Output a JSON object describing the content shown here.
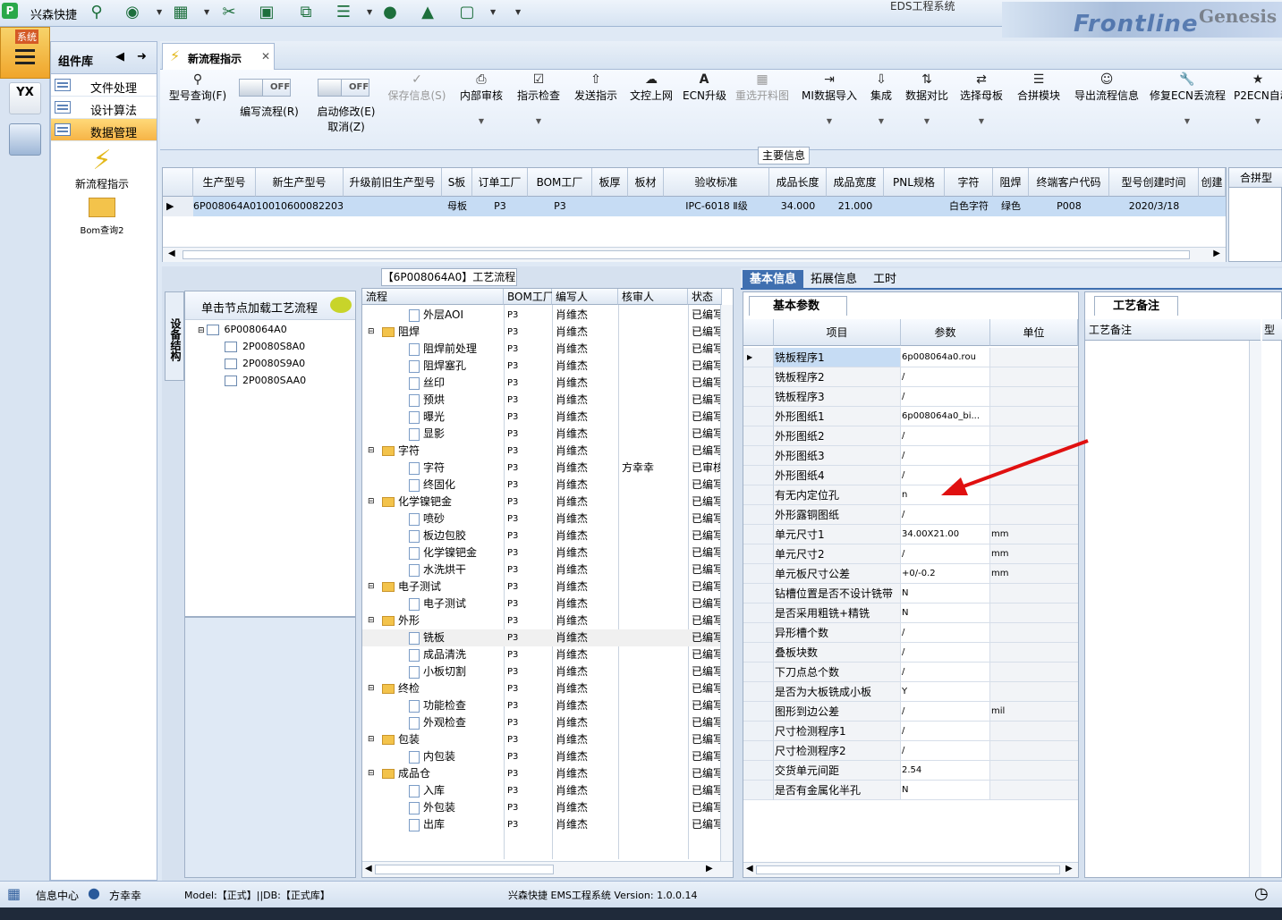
{
  "app": {
    "name": "兴森快捷",
    "window_title": "EDS工程系统",
    "banner_text": "Frontline",
    "banner_text2": "Genesis"
  },
  "system": {
    "label": "系统"
  },
  "component_panel": {
    "title": "组件库",
    "items": [
      {
        "label": "文件处理"
      },
      {
        "label": "设计算法"
      },
      {
        "label": "数据管理",
        "selected": true
      }
    ],
    "icons": [
      {
        "label": "新流程指示"
      },
      {
        "label": "Bom查询2"
      }
    ]
  },
  "doc_tab": {
    "label": "新流程指示"
  },
  "toolbar": {
    "items": [
      {
        "label": "型号查询(F)",
        "icon": "search-icon"
      },
      {
        "label": "编写流程(R)",
        "toggle": "OFF"
      },
      {
        "label": "启动修改(E)",
        "label2": "取消(Z)",
        "toggle": "OFF"
      },
      {
        "label": "保存信息(S)",
        "icon": "check-icon",
        "disabled": true
      },
      {
        "label": "内部审核",
        "icon": "printer-icon"
      },
      {
        "label": "指示检查",
        "icon": "checkbox-icon"
      },
      {
        "label": "发送指示",
        "icon": "upload-icon"
      },
      {
        "label": "文控上网",
        "icon": "cloud-upload-icon"
      },
      {
        "label": "ECN升级",
        "icon": "bold-a-icon"
      },
      {
        "label": "重选开料图",
        "icon": "image-icon",
        "disabled": true
      },
      {
        "label": "MI数据导入",
        "icon": "import-icon"
      },
      {
        "label": "集成",
        "icon": "download-icon"
      },
      {
        "label": "数据对比",
        "icon": "compare-icon"
      },
      {
        "label": "选择母板",
        "icon": "shuffle-icon"
      },
      {
        "label": "合拼模块",
        "icon": "list-icon"
      },
      {
        "label": "导出流程信息",
        "icon": "smile-icon"
      },
      {
        "label": "修复ECN丢流程",
        "icon": "wrench-icon"
      },
      {
        "label": "P2ECN自动",
        "icon": "star-icon"
      }
    ]
  },
  "main_info": {
    "label": "主要信息"
  },
  "grid1": {
    "columns": [
      "生产型号",
      "新生产型号",
      "升级前旧生产型号",
      "S板",
      "订单工厂",
      "BOM工厂",
      "板厚",
      "板材",
      "验收标准",
      "成品长度",
      "成品宽度",
      "PNL规格",
      "字符",
      "阻焊",
      "终端客户代码",
      "型号创建时间",
      "创建"
    ],
    "rows": [
      [
        "6P008064A0",
        "10010600082203",
        "",
        "母板",
        "P3",
        "P3",
        "",
        "",
        "IPC-6018 Ⅱ级",
        "34.000",
        "21.000",
        "",
        "白色字符",
        "绿色",
        "P008",
        "2020/3/18",
        ""
      ]
    ],
    "right_header": "合拼型"
  },
  "flow_title": "【6P008064A0】工艺流程",
  "structure_tab": "设备结构",
  "tree": {
    "header": "单击节点加载工艺流程",
    "root": "6P008064A0",
    "children": [
      "2P0080S8A0",
      "2P0080S9A0",
      "2P0080SAA0"
    ]
  },
  "flow": {
    "columns": [
      "流程",
      "BOM工厂",
      "编写人",
      "核审人",
      "状态"
    ],
    "rows": [
      {
        "name": "外层AOI",
        "level": 2,
        "bom": "P3",
        "writer": "肖维杰",
        "reviewer": "",
        "status": "已编写"
      },
      {
        "name": "阻焊",
        "level": 1,
        "bom": "P3",
        "writer": "肖维杰",
        "reviewer": "",
        "status": "已编写"
      },
      {
        "name": "阻焊前处理",
        "level": 2,
        "bom": "P3",
        "writer": "肖维杰",
        "reviewer": "",
        "status": "已编写"
      },
      {
        "name": "阻焊塞孔",
        "level": 2,
        "bom": "P3",
        "writer": "肖维杰",
        "reviewer": "",
        "status": "已编写"
      },
      {
        "name": "丝印",
        "level": 2,
        "bom": "P3",
        "writer": "肖维杰",
        "reviewer": "",
        "status": "已编写"
      },
      {
        "name": "预烘",
        "level": 2,
        "bom": "P3",
        "writer": "肖维杰",
        "reviewer": "",
        "status": "已编写"
      },
      {
        "name": "曝光",
        "level": 2,
        "bom": "P3",
        "writer": "肖维杰",
        "reviewer": "",
        "status": "已编写"
      },
      {
        "name": "显影",
        "level": 2,
        "bom": "P3",
        "writer": "肖维杰",
        "reviewer": "",
        "status": "已编写"
      },
      {
        "name": "字符",
        "level": 1,
        "bom": "P3",
        "writer": "肖维杰",
        "reviewer": "",
        "status": "已编写"
      },
      {
        "name": "字符",
        "level": 2,
        "bom": "P3",
        "writer": "肖维杰",
        "reviewer": "方幸幸",
        "status": "已审核"
      },
      {
        "name": "终固化",
        "level": 2,
        "bom": "P3",
        "writer": "肖维杰",
        "reviewer": "",
        "status": "已编写"
      },
      {
        "name": "化学镍钯金",
        "level": 1,
        "bom": "P3",
        "writer": "肖维杰",
        "reviewer": "",
        "status": "已编写"
      },
      {
        "name": "喷砂",
        "level": 2,
        "bom": "P3",
        "writer": "肖维杰",
        "reviewer": "",
        "status": "已编写"
      },
      {
        "name": "板边包胶",
        "level": 2,
        "bom": "P3",
        "writer": "肖维杰",
        "reviewer": "",
        "status": "已编写"
      },
      {
        "name": "化学镍钯金",
        "level": 2,
        "bom": "P3",
        "writer": "肖维杰",
        "reviewer": "",
        "status": "已编写"
      },
      {
        "name": "水洗烘干",
        "level": 2,
        "bom": "P3",
        "writer": "肖维杰",
        "reviewer": "",
        "status": "已编写"
      },
      {
        "name": "电子测试",
        "level": 1,
        "bom": "P3",
        "writer": "肖维杰",
        "reviewer": "",
        "status": "已编写"
      },
      {
        "name": "电子测试",
        "level": 2,
        "bom": "P3",
        "writer": "肖维杰",
        "reviewer": "",
        "status": "已编写"
      },
      {
        "name": "外形",
        "level": 1,
        "bom": "P3",
        "writer": "肖维杰",
        "reviewer": "",
        "status": "已编写"
      },
      {
        "name": "铣板",
        "level": 2,
        "bom": "P3",
        "writer": "肖维杰",
        "reviewer": "",
        "status": "已编写",
        "selected": true
      },
      {
        "name": "成品清洗",
        "level": 2,
        "bom": "P3",
        "writer": "肖维杰",
        "reviewer": "",
        "status": "已编写"
      },
      {
        "name": "小板切割",
        "level": 2,
        "bom": "P3",
        "writer": "肖维杰",
        "reviewer": "",
        "status": "已编写"
      },
      {
        "name": "终检",
        "level": 1,
        "bom": "P3",
        "writer": "肖维杰",
        "reviewer": "",
        "status": "已编写"
      },
      {
        "name": "功能检查",
        "level": 2,
        "bom": "P3",
        "writer": "肖维杰",
        "reviewer": "",
        "status": "已编写"
      },
      {
        "name": "外观检查",
        "level": 2,
        "bom": "P3",
        "writer": "肖维杰",
        "reviewer": "",
        "status": "已编写"
      },
      {
        "name": "包装",
        "level": 1,
        "bom": "P3",
        "writer": "肖维杰",
        "reviewer": "",
        "status": "已编写"
      },
      {
        "name": "内包装",
        "level": 2,
        "bom": "P3",
        "writer": "肖维杰",
        "reviewer": "",
        "status": "已编写"
      },
      {
        "name": "成品仓",
        "level": 1,
        "bom": "P3",
        "writer": "肖维杰",
        "reviewer": "",
        "status": "已编写"
      },
      {
        "name": "入库",
        "level": 2,
        "bom": "P3",
        "writer": "肖维杰",
        "reviewer": "",
        "status": "已编写"
      },
      {
        "name": "外包装",
        "level": 2,
        "bom": "P3",
        "writer": "肖维杰",
        "reviewer": "",
        "status": "已编写"
      },
      {
        "name": "出库",
        "level": 2,
        "bom": "P3",
        "writer": "肖维杰",
        "reviewer": "",
        "status": "已编写"
      }
    ]
  },
  "right_tabs": [
    "基本信息",
    "拓展信息",
    "工时"
  ],
  "basic": {
    "sub_tab": "基本参数",
    "columns": [
      "项目",
      "参数",
      "单位"
    ],
    "rows": [
      [
        "铣板程序1",
        "6p008064a0.rou",
        ""
      ],
      [
        "铣板程序2",
        "/",
        ""
      ],
      [
        "铣板程序3",
        "/",
        ""
      ],
      [
        "外形图纸1",
        "6p008064a0_bi...",
        ""
      ],
      [
        "外形图纸2",
        "/",
        ""
      ],
      [
        "外形图纸3",
        "/",
        ""
      ],
      [
        "外形图纸4",
        "/",
        ""
      ],
      [
        "有无内定位孔",
        "n",
        ""
      ],
      [
        "外形露铜图纸",
        "/",
        ""
      ],
      [
        "单元尺寸1",
        "34.00X21.00",
        "mm"
      ],
      [
        "单元尺寸2",
        "/",
        "mm"
      ],
      [
        "单元板尺寸公差",
        "+0/-0.2",
        "mm"
      ],
      [
        "钻槽位置是否不设计铣带",
        "N",
        ""
      ],
      [
        "是否采用粗铣+精铣",
        "N",
        ""
      ],
      [
        "异形槽个数",
        "/",
        ""
      ],
      [
        "叠板块数",
        "/",
        ""
      ],
      [
        "下刀点总个数",
        "/",
        ""
      ],
      [
        "是否为大板铣成小板",
        "Y",
        ""
      ],
      [
        "图形到边公差",
        "/",
        "mil"
      ],
      [
        "尺寸检测程序1",
        "/",
        ""
      ],
      [
        "尺寸检测程序2",
        "/",
        ""
      ],
      [
        "交货单元间距",
        "2.54",
        ""
      ],
      [
        "是否有金属化半孔",
        "N",
        ""
      ]
    ]
  },
  "craft": {
    "tab": "工艺备注",
    "col1": "工艺备注",
    "col2": "型号"
  },
  "status": {
    "info_center": "信息中心",
    "user": "方幸幸",
    "model": "Model:【正式】||DB:【正式库】",
    "system": "兴森快捷 EMS工程系统 Version: 1.0.0.14"
  },
  "colors": {
    "accent": "#3f6fb0",
    "selection": "#c6dcf4",
    "highlight": "#f6b447",
    "arrow": "#e01010"
  }
}
